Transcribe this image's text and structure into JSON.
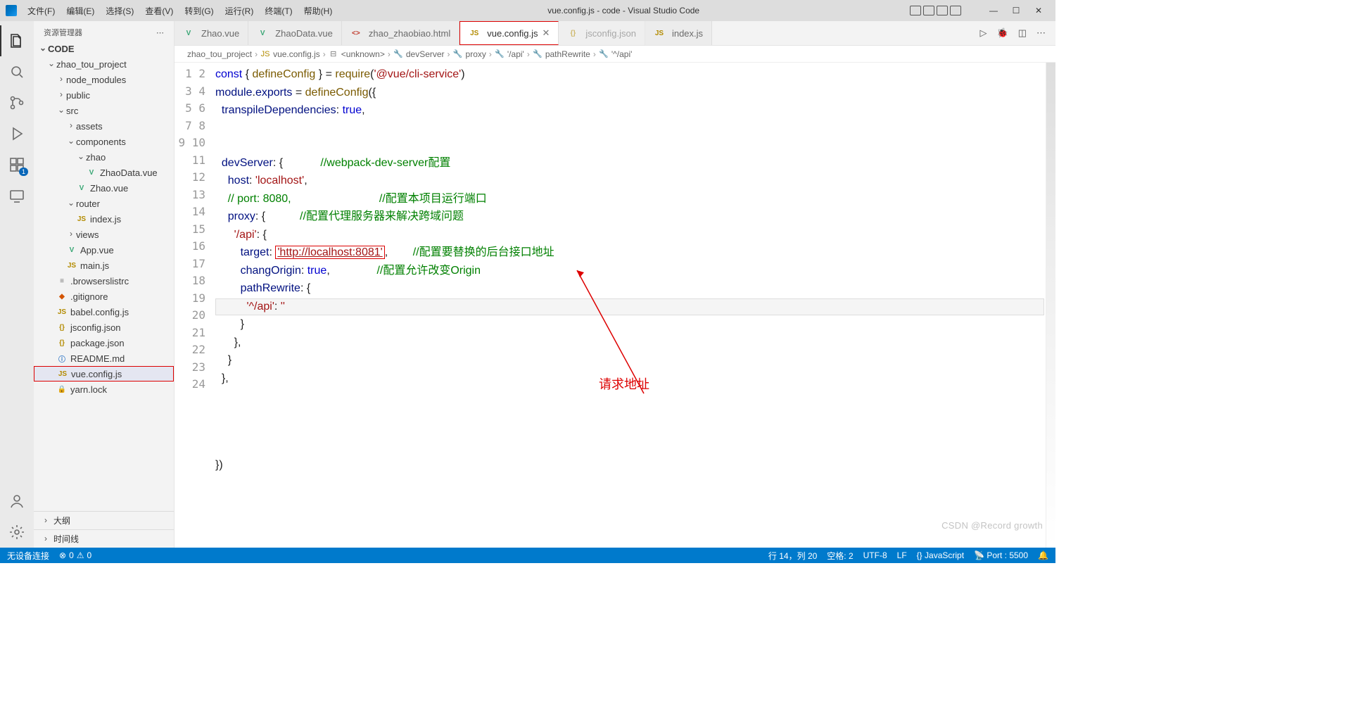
{
  "menu": [
    "文件(F)",
    "编辑(E)",
    "选择(S)",
    "查看(V)",
    "转到(G)",
    "运行(R)",
    "终端(T)",
    "帮助(H)"
  ],
  "window_title": "vue.config.js - code - Visual Studio Code",
  "sidebar": {
    "title": "资源管理器",
    "root": "CODE",
    "project": "zhao_tou_project",
    "items": {
      "node_modules": "node_modules",
      "public": "public",
      "src": "src",
      "assets": "assets",
      "components": "components",
      "zhao": "zhao",
      "zhaodatavue": "ZhaoData.vue",
      "zhaovue": "Zhao.vue",
      "router": "router",
      "indexjs": "index.js",
      "views": "views",
      "appvue": "App.vue",
      "mainjs": "main.js",
      "browserslist": ".browserslistrc",
      "gitignore": ".gitignore",
      "babel": "babel.config.js",
      "jsconfig": "jsconfig.json",
      "package": "package.json",
      "readme": "README.md",
      "vueconfig": "vue.config.js",
      "yarnlock": "yarn.lock"
    },
    "outline": "大纲",
    "timeline": "时间线"
  },
  "tabs": [
    {
      "icon": "V",
      "cls": "ic-vue",
      "label": "Zhao.vue"
    },
    {
      "icon": "V",
      "cls": "ic-vue",
      "label": "ZhaoData.vue"
    },
    {
      "icon": "<>",
      "cls": "ic-txt",
      "label": "zhao_zhaobiao.html"
    },
    {
      "icon": "JS",
      "cls": "ic-js",
      "label": "vue.config.js",
      "active": true,
      "close": true
    },
    {
      "icon": "{}",
      "cls": "ic-json",
      "label": "jsconfig.json",
      "dim": true
    },
    {
      "icon": "JS",
      "cls": "ic-js",
      "label": "index.js"
    }
  ],
  "breadcrumb": [
    "zhao_tou_project",
    "vue.config.js",
    "<unknown>",
    "devServer",
    "proxy",
    "'/api'",
    "pathRewrite",
    "'^/api'"
  ],
  "code": {
    "l1a": "const",
    "l1b": " { ",
    "l1c": "defineConfig",
    "l1d": " } = ",
    "l1e": "require",
    "l1f": "(",
    "l1g": "'@vue/cli-service'",
    "l1h": ")",
    "l2a": "module",
    "l2b": ".",
    "l2c": "exports",
    "l2d": " = ",
    "l2e": "defineConfig",
    "l2f": "({",
    "l3a": "  transpileDependencies",
    "l3b": ": ",
    "l3c": "true",
    "l3d": ",",
    "l6a": "  devServer",
    "l6b": ": {            ",
    "l6c": "//webpack-dev-server配置",
    "l7a": "    host",
    "l7b": ": ",
    "l7c": "'localhost'",
    "l7d": ",",
    "l8a": "    // port: 8080,",
    "l8c": "//配置本项目运行端口",
    "l9a": "    proxy",
    "l9b": ": {           ",
    "l9c": "//配置代理服务器来解决跨域问题",
    "l10a": "      '/api'",
    "l10b": ": {",
    "l11a": "        target",
    "l11b": ": ",
    "l11c": "'http://localhost:8081'",
    "l11d": ",        ",
    "l11e": "//配置要替换的后台接口地址",
    "l12a": "        changOrigin",
    "l12b": ": ",
    "l12c": "true",
    "l12d": ",               ",
    "l12e": "//配置允许改变Origin",
    "l13a": "        pathRewrite",
    "l13b": ": {",
    "l14a": "          '^/api'",
    "l14b": ": ",
    "l14c": "''",
    "l15": "        }",
    "l16": "      },",
    "l17": "    }",
    "l18": "  },",
    "l23": "})"
  },
  "annot": {
    "label": "请求地址"
  },
  "status": {
    "left1": "无设备连接",
    "err": "0",
    "warn": "0",
    "pos": "行 14，列 20",
    "spaces": "空格: 2",
    "enc": "UTF-8",
    "eol": "LF",
    "lang": "JavaScript",
    "live": "Port : 5500",
    "bell": "🔔"
  },
  "watermark": "CSDN @Record growth"
}
